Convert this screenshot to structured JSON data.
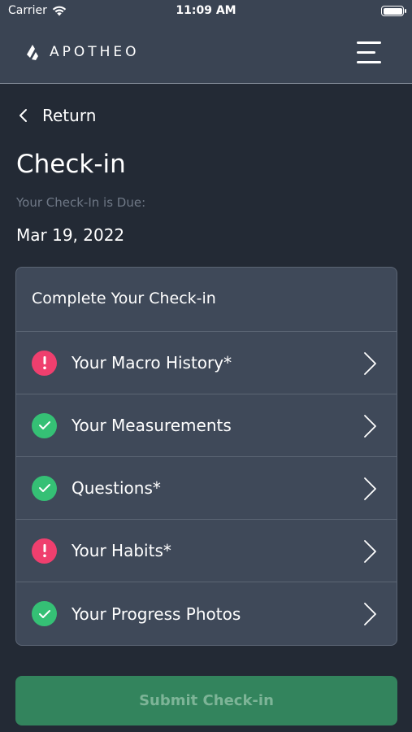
{
  "status_bar": {
    "carrier": "Carrier",
    "time": "11:09 AM"
  },
  "header": {
    "brand": "APOTHEO"
  },
  "nav": {
    "return_label": "Return"
  },
  "page": {
    "title": "Check-in",
    "due_label": "Your Check-In is Due:",
    "due_date": "Mar 19, 2022"
  },
  "checkin": {
    "heading": "Complete Your Check-in",
    "items": [
      {
        "label": "Your Macro History*",
        "status": "incomplete",
        "icon": "exclamation-icon"
      },
      {
        "label": "Your Measurements",
        "status": "complete",
        "icon": "check-icon"
      },
      {
        "label": "Questions*",
        "status": "complete",
        "icon": "check-icon"
      },
      {
        "label": "Your Habits*",
        "status": "incomplete",
        "icon": "exclamation-icon"
      },
      {
        "label": "Your Progress Photos",
        "status": "complete",
        "icon": "check-icon"
      }
    ]
  },
  "submit": {
    "label": "Submit Check-in",
    "disabled": true
  },
  "colors": {
    "background": "#232a35",
    "header": "#3a4453",
    "card": "#3f4959",
    "incomplete": "#ef3f6e",
    "complete": "#35c075",
    "submit": "#33845d"
  }
}
